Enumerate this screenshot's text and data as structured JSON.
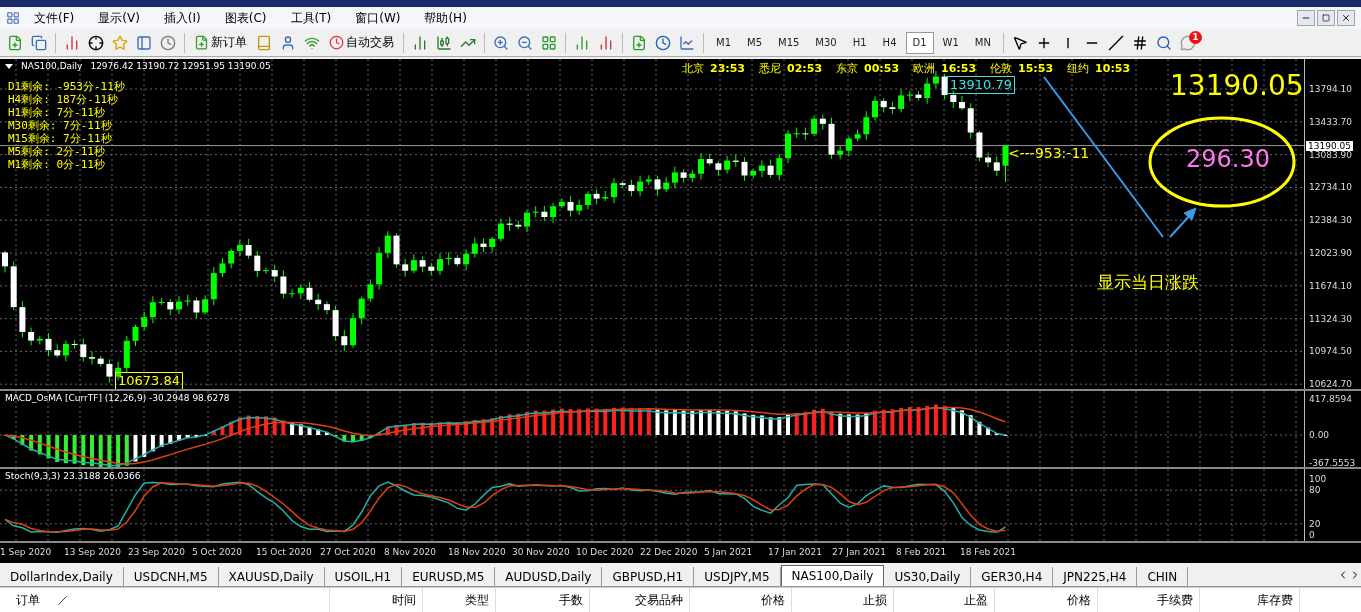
{
  "menu": [
    "文件(F)",
    "显示(V)",
    "插入(I)",
    "图表(C)",
    "工具(T)",
    "窗口(W)",
    "帮助(H)"
  ],
  "toolbar": {
    "buttons": [
      {
        "label": "新订单"
      },
      {
        "label": "自动交易"
      }
    ],
    "timeframes": [
      {
        "label": "M1",
        "selected": false
      },
      {
        "label": "M5",
        "selected": false
      },
      {
        "label": "M15",
        "selected": false
      },
      {
        "label": "M30",
        "selected": false
      },
      {
        "label": "H1",
        "selected": false
      },
      {
        "label": "H4",
        "selected": false
      },
      {
        "label": "D1",
        "selected": true
      },
      {
        "label": "W1",
        "selected": false
      },
      {
        "label": "MN",
        "selected": false
      }
    ],
    "notification_count": "1"
  },
  "chart": {
    "symbol": "NAS100,Daily",
    "quote": "12976.42 13190.72 12951.95 13190.05",
    "countdowns": [
      "D1剩余: -953分-11秒",
      "H4剩余: 187分-11秒",
      "H1剩余: 7分-11秒",
      "M30剩余: 7分-11秒",
      "M15剩余: 7分-11秒",
      "M5剩余: 2分-11秒",
      "M1剩余: 0分-11秒"
    ],
    "sessions": [
      {
        "city": "北京",
        "time": "23:53"
      },
      {
        "city": "悉尼",
        "time": "02:53"
      },
      {
        "city": "东京",
        "time": "00:53"
      },
      {
        "city": "欧洲",
        "time": "16:53"
      },
      {
        "city": "伦敦",
        "time": "15:53"
      },
      {
        "city": "纽约",
        "time": "10:53"
      }
    ],
    "high_label": "13910.79",
    "low_label": "10673.84",
    "countdown_marker": "<---953:-11",
    "current_price": "13190.05",
    "daily_change": "296.30",
    "annotation": "显示当日涨跌",
    "price_axis": [
      "13794.10",
      "13433.70",
      "13083.90",
      "12734.10",
      "12384.30",
      "12023.90",
      "11674.10",
      "11324.30",
      "10974.50",
      "10624.70"
    ],
    "price_tag": "13190.05"
  },
  "macd": {
    "title": "MACD_OsMA [CurrTF] (12,26,9) -30.2948 98.6278",
    "axis": [
      "417.8594",
      "0.00",
      "-367.5553"
    ]
  },
  "stoch": {
    "title": "Stoch(9,3,3) 23.3188 26.0366",
    "axis": [
      "100",
      "80",
      "20",
      "0"
    ]
  },
  "date_axis": [
    "1 Sep 2020",
    "13 Sep 2020",
    "23 Sep 2020",
    "5 Oct 2020",
    "15 Oct 2020",
    "27 Oct 2020",
    "8 Nov 2020",
    "18 Nov 2020",
    "30 Nov 2020",
    "10 Dec 2020",
    "22 Dec 2020",
    "5 Jan 2021",
    "17 Jan 2021",
    "27 Jan 2021",
    "8 Feb 2021",
    "18 Feb 2021"
  ],
  "tabs": [
    {
      "label": "DollarIndex,Daily",
      "selected": false
    },
    {
      "label": "USDCNH,M5",
      "selected": false
    },
    {
      "label": "XAUUSD,Daily",
      "selected": false
    },
    {
      "label": "USOIL,H1",
      "selected": false
    },
    {
      "label": "EURUSD,M5",
      "selected": false
    },
    {
      "label": "AUDUSD,Daily",
      "selected": false
    },
    {
      "label": "GBPUSD,H1",
      "selected": false
    },
    {
      "label": "USDJPY,M5",
      "selected": false
    },
    {
      "label": "NAS100,Daily",
      "selected": true
    },
    {
      "label": "US30,Daily",
      "selected": false
    },
    {
      "label": "GER30,H4",
      "selected": false
    },
    {
      "label": "JPN225,H4",
      "selected": false
    },
    {
      "label": "CHIN",
      "selected": false
    }
  ],
  "orders_table": {
    "columns": [
      "订单",
      "时间",
      "类型",
      "手数",
      "交易品种",
      "价格",
      "止损",
      "止盈",
      "价格",
      "手续费",
      "库存费"
    ]
  }
}
